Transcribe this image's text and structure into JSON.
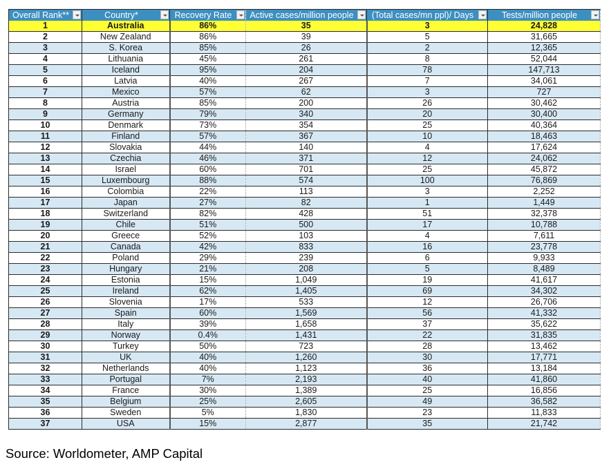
{
  "table": {
    "columns": [
      {
        "label": "Overall Rank**",
        "filter_icon": "dropdown-arrow-icon"
      },
      {
        "label": "Country*",
        "filter_icon": "dropdown-arrow-icon"
      },
      {
        "label": "Recovery Rate",
        "filter_icon": "dropdown-arrow-icon"
      },
      {
        "label": "Active cases/million people",
        "filter_icon": "dropdown-arrow-icon"
      },
      {
        "label": "(Total cases/mn ppl)/ Days",
        "filter_icon": "dropdown-arrow-icon"
      },
      {
        "label": "Tests/million people",
        "filter_icon": "dropdown-arrow-icon"
      }
    ],
    "highlight_color": "#ffff33",
    "header_color": "#3d8fc0",
    "band_color": "#d6e8f3",
    "rows": [
      [
        "1",
        "Australia",
        "86%",
        "35",
        "3",
        "24,828"
      ],
      [
        "2",
        "New Zealand",
        "86%",
        "39",
        "5",
        "31,665"
      ],
      [
        "3",
        "S. Korea",
        "85%",
        "26",
        "2",
        "12,365"
      ],
      [
        "4",
        "Lithuania",
        "45%",
        "261",
        "8",
        "52,044"
      ],
      [
        "5",
        "Iceland",
        "95%",
        "204",
        "78",
        "147,713"
      ],
      [
        "6",
        "Latvia",
        "40%",
        "267",
        "7",
        "34,061"
      ],
      [
        "7",
        "Mexico",
        "57%",
        "62",
        "3",
        "727"
      ],
      [
        "8",
        "Austria",
        "85%",
        "200",
        "26",
        "30,462"
      ],
      [
        "9",
        "Germany",
        "79%",
        "340",
        "20",
        "30,400"
      ],
      [
        "10",
        "Denmark",
        "73%",
        "354",
        "25",
        "40,364"
      ],
      [
        "11",
        "Finland",
        "57%",
        "367",
        "10",
        "18,463"
      ],
      [
        "12",
        "Slovakia",
        "44%",
        "140",
        "4",
        "17,624"
      ],
      [
        "13",
        "Czechia",
        "46%",
        "371",
        "12",
        "24,062"
      ],
      [
        "14",
        "Israel",
        "60%",
        "701",
        "25",
        "45,872"
      ],
      [
        "15",
        "Luxembourg",
        "88%",
        "574",
        "100",
        "76,869"
      ],
      [
        "16",
        "Colombia",
        "22%",
        "113",
        "3",
        "2,252"
      ],
      [
        "17",
        "Japan",
        "27%",
        "82",
        "1",
        "1,449"
      ],
      [
        "18",
        "Switzerland",
        "82%",
        "428",
        "51",
        "32,378"
      ],
      [
        "19",
        "Chile",
        "51%",
        "500",
        "17",
        "10,788"
      ],
      [
        "20",
        "Greece",
        "52%",
        "103",
        "4",
        "7,611"
      ],
      [
        "21",
        "Canada",
        "42%",
        "833",
        "16",
        "23,778"
      ],
      [
        "22",
        "Poland",
        "29%",
        "239",
        "6",
        "9,933"
      ],
      [
        "23",
        "Hungary",
        "21%",
        "208",
        "5",
        "8,489"
      ],
      [
        "24",
        "Estonia",
        "15%",
        "1,049",
        "19",
        "41,617"
      ],
      [
        "25",
        "Ireland",
        "62%",
        "1,405",
        "69",
        "34,302"
      ],
      [
        "26",
        "Slovenia",
        "17%",
        "533",
        "12",
        "26,706"
      ],
      [
        "27",
        "Spain",
        "60%",
        "1,569",
        "56",
        "41,332"
      ],
      [
        "28",
        "Italy",
        "39%",
        "1,658",
        "37",
        "35,622"
      ],
      [
        "29",
        "Norway",
        "0.4%",
        "1,431",
        "22",
        "31,835"
      ],
      [
        "30",
        "Turkey",
        "50%",
        "723",
        "28",
        "13,462"
      ],
      [
        "31",
        "UK",
        "40%",
        "1,260",
        "30",
        "17,771"
      ],
      [
        "32",
        "Netherlands",
        "40%",
        "1,123",
        "36",
        "13,184"
      ],
      [
        "33",
        "Portugal",
        "7%",
        "2,193",
        "40",
        "41,860"
      ],
      [
        "34",
        "France",
        "30%",
        "1,389",
        "25",
        "16,856"
      ],
      [
        "35",
        "Belgium",
        "25%",
        "2,605",
        "49",
        "36,582"
      ],
      [
        "36",
        "Sweden",
        "5%",
        "1,830",
        "23",
        "11,833"
      ],
      [
        "37",
        "USA",
        "15%",
        "2,877",
        "35",
        "21,742"
      ]
    ]
  },
  "source": "Source: Worldometer, AMP Capital"
}
